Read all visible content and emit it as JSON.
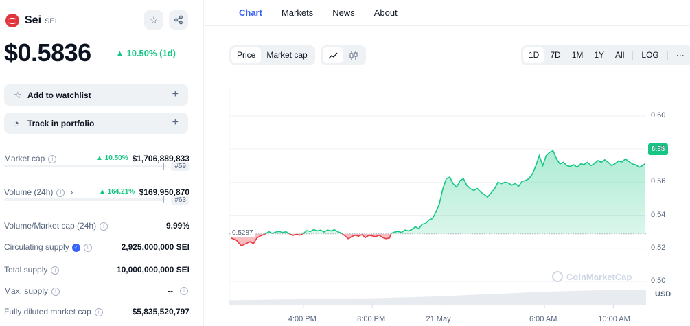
{
  "coin": {
    "name": "Sei",
    "symbol": "SEI",
    "price": "$0.5836",
    "change": "▲ 10.50% (1d)"
  },
  "actions": {
    "watchlist": "Add to watchlist",
    "portfolio": "Track in portfolio"
  },
  "stats": {
    "market_cap": {
      "label": "Market cap",
      "change": "▲ 10.50%",
      "value": "$1,706,889,833",
      "rank": "#59"
    },
    "volume": {
      "label": "Volume (24h)",
      "change": "▲ 164.21%",
      "value": "$169,950,870",
      "rank": "#63"
    },
    "vol_mcap": {
      "label": "Volume/Market cap (24h)",
      "value": "9.99%"
    },
    "circulating": {
      "label": "Circulating supply",
      "value": "2,925,000,000 SEI"
    },
    "total": {
      "label": "Total supply",
      "value": "10,000,000,000 SEI"
    },
    "max": {
      "label": "Max. supply",
      "value": "--"
    },
    "fdmc": {
      "label": "Fully diluted market cap",
      "value": "$5,835,520,797"
    }
  },
  "tabs": [
    "Chart",
    "Markets",
    "News",
    "About"
  ],
  "controls": {
    "type_options": [
      "Price",
      "Market cap"
    ],
    "ranges": [
      "1D",
      "7D",
      "1M",
      "1Y",
      "All"
    ],
    "log": "LOG",
    "more": "···"
  },
  "colors": {
    "up": "#16c784",
    "down": "#ea3943",
    "accent": "#3861fb"
  },
  "chart_data": {
    "type": "area",
    "currency": "USD",
    "open_price": "0.5287",
    "current_price": "0.58",
    "y_ticks": [
      "0.60",
      "0.58",
      "0.56",
      "0.54",
      "0.52",
      "0.50"
    ],
    "ylim": [
      0.495,
      0.617
    ],
    "x_ticks": [
      "4:00 PM",
      "8:00 PM",
      "21 May",
      "6:00 AM",
      "10:00 AM"
    ],
    "watermark": "CoinMarketCap",
    "axis_unit": "USD",
    "x_range_hours": [
      11.7,
      35.9
    ],
    "x_tick_hours": [
      16,
      20,
      24,
      30,
      34
    ],
    "points": [
      [
        11.8,
        0.5262
      ],
      [
        12.1,
        0.525
      ],
      [
        12.4,
        0.5215
      ],
      [
        12.6,
        0.5225
      ],
      [
        12.9,
        0.524
      ],
      [
        13.1,
        0.5228
      ],
      [
        13.3,
        0.5262
      ],
      [
        13.5,
        0.5275
      ],
      [
        13.7,
        0.5282
      ],
      [
        14.0,
        0.53
      ],
      [
        14.2,
        0.529
      ],
      [
        14.4,
        0.5298
      ],
      [
        14.6,
        0.5302
      ],
      [
        14.8,
        0.5296
      ],
      [
        15.0,
        0.53
      ],
      [
        15.2,
        0.5287
      ],
      [
        15.4,
        0.5278
      ],
      [
        15.6,
        0.5285
      ],
      [
        15.8,
        0.5279
      ],
      [
        16.0,
        0.529
      ],
      [
        16.2,
        0.5307
      ],
      [
        16.4,
        0.5301
      ],
      [
        16.6,
        0.5313
      ],
      [
        16.8,
        0.5305
      ],
      [
        17.0,
        0.531
      ],
      [
        17.2,
        0.5298
      ],
      [
        17.4,
        0.531
      ],
      [
        17.6,
        0.5305
      ],
      [
        17.8,
        0.5312
      ],
      [
        18.0,
        0.53
      ],
      [
        18.2,
        0.5292
      ],
      [
        18.4,
        0.5277
      ],
      [
        18.6,
        0.5258
      ],
      [
        18.8,
        0.527
      ],
      [
        19.0,
        0.5279
      ],
      [
        19.2,
        0.5273
      ],
      [
        19.4,
        0.5282
      ],
      [
        19.6,
        0.5265
      ],
      [
        19.8,
        0.5278
      ],
      [
        20.0,
        0.5275
      ],
      [
        20.2,
        0.527
      ],
      [
        20.4,
        0.5279
      ],
      [
        20.6,
        0.5265
      ],
      [
        20.8,
        0.5258
      ],
      [
        21.0,
        0.5262
      ],
      [
        21.1,
        0.529
      ],
      [
        21.3,
        0.5298
      ],
      [
        21.5,
        0.5302
      ],
      [
        21.7,
        0.5296
      ],
      [
        21.9,
        0.531
      ],
      [
        22.1,
        0.5305
      ],
      [
        22.3,
        0.5313
      ],
      [
        22.5,
        0.533
      ],
      [
        22.7,
        0.5318
      ],
      [
        22.9,
        0.5345
      ],
      [
        23.1,
        0.535
      ],
      [
        23.3,
        0.5372
      ],
      [
        23.5,
        0.538
      ],
      [
        23.7,
        0.542
      ],
      [
        23.9,
        0.547
      ],
      [
        24.1,
        0.556
      ],
      [
        24.3,
        0.562
      ],
      [
        24.5,
        0.563
      ],
      [
        24.7,
        0.559
      ],
      [
        24.9,
        0.557
      ],
      [
        25.1,
        0.561
      ],
      [
        25.3,
        0.562
      ],
      [
        25.5,
        0.558
      ],
      [
        25.7,
        0.556
      ],
      [
        25.9,
        0.555
      ],
      [
        26.1,
        0.5562
      ],
      [
        26.3,
        0.554
      ],
      [
        26.5,
        0.5525
      ],
      [
        26.7,
        0.551
      ],
      [
        26.9,
        0.5535
      ],
      [
        27.1,
        0.556
      ],
      [
        27.3,
        0.56
      ],
      [
        27.5,
        0.559
      ],
      [
        27.7,
        0.56
      ],
      [
        27.9,
        0.5595
      ],
      [
        28.1,
        0.5582
      ],
      [
        28.3,
        0.5592
      ],
      [
        28.5,
        0.5575
      ],
      [
        28.7,
        0.5605
      ],
      [
        28.9,
        0.561
      ],
      [
        29.1,
        0.562
      ],
      [
        29.3,
        0.565
      ],
      [
        29.5,
        0.57
      ],
      [
        29.7,
        0.576
      ],
      [
        29.9,
        0.57
      ],
      [
        30.1,
        0.576
      ],
      [
        30.3,
        0.578
      ],
      [
        30.5,
        0.579
      ],
      [
        30.7,
        0.574
      ],
      [
        30.9,
        0.571
      ],
      [
        31.1,
        0.572
      ],
      [
        31.3,
        0.57
      ],
      [
        31.5,
        0.5695
      ],
      [
        31.7,
        0.5705
      ],
      [
        31.9,
        0.569
      ],
      [
        32.1,
        0.571
      ],
      [
        32.3,
        0.5706
      ],
      [
        32.5,
        0.572
      ],
      [
        32.7,
        0.57
      ],
      [
        32.9,
        0.5712
      ],
      [
        33.1,
        0.573
      ],
      [
        33.3,
        0.572
      ],
      [
        33.5,
        0.5735
      ],
      [
        33.7,
        0.572
      ],
      [
        33.9,
        0.57
      ],
      [
        34.1,
        0.5712
      ],
      [
        34.3,
        0.5728
      ],
      [
        34.5,
        0.5722
      ],
      [
        34.7,
        0.574
      ],
      [
        34.9,
        0.5725
      ],
      [
        35.1,
        0.571
      ],
      [
        35.3,
        0.5705
      ],
      [
        35.5,
        0.569
      ],
      [
        35.7,
        0.57
      ],
      [
        35.85,
        0.5712
      ]
    ],
    "volume_trend": [
      0.3,
      0.35,
      0.38,
      0.45,
      0.55,
      0.7,
      0.85,
      0.95,
      1.0
    ]
  }
}
